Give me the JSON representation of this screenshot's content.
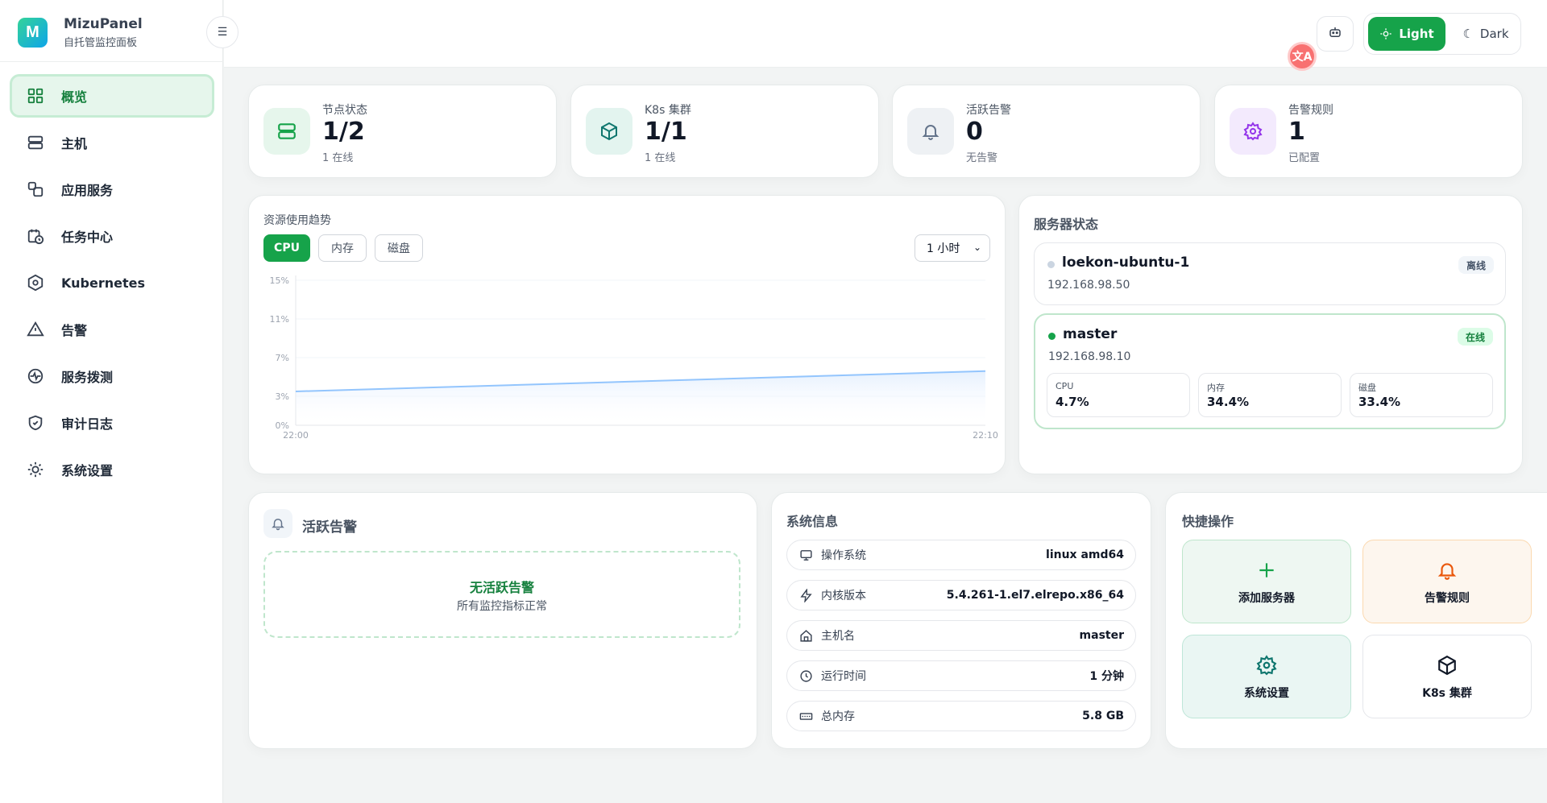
{
  "brand": {
    "name": "MizuPanel",
    "subtitle": "自托管监控面板",
    "logo_letter": "M"
  },
  "sidebar": {
    "items": [
      {
        "label": "概览",
        "icon": "grid-icon",
        "active": true
      },
      {
        "label": "主机",
        "icon": "server-icon"
      },
      {
        "label": "应用服务",
        "icon": "services-icon"
      },
      {
        "label": "任务中心",
        "icon": "calendar-clock-icon"
      },
      {
        "label": "Kubernetes",
        "icon": "kubernetes-icon"
      },
      {
        "label": "告警",
        "icon": "warning-icon"
      },
      {
        "label": "服务拨测",
        "icon": "pulse-icon"
      },
      {
        "label": "审计日志",
        "icon": "shield-icon"
      },
      {
        "label": "系统设置",
        "icon": "sun-gear-icon"
      }
    ]
  },
  "topbar": {
    "theme_light": "Light",
    "theme_dark": "Dark",
    "translate": "文A"
  },
  "stats": [
    {
      "label": "节点状态",
      "value": "1/2",
      "sub": "1 在线",
      "icon": "server-icon",
      "color": "#16a34a",
      "bg": "#e6f6ec"
    },
    {
      "label": "K8s 集群",
      "value": "1/1",
      "sub": "1 在线",
      "icon": "cube-icon",
      "color": "#0f766e",
      "bg": "#e3f4ef"
    },
    {
      "label": "活跃告警",
      "value": "0",
      "sub": "无告警",
      "icon": "bell-icon",
      "color": "#64748b",
      "bg": "#eef1f4"
    },
    {
      "label": "告警规则",
      "value": "1",
      "sub": "已配置",
      "icon": "gear-icon",
      "color": "#9333ea",
      "bg": "#f3eafd"
    }
  ],
  "trend": {
    "title": "资源使用趋势",
    "tabs": [
      "CPU",
      "内存",
      "磁盘"
    ],
    "range": "1 小时",
    "y_ticks": [
      "15%",
      "11%",
      "7%",
      "3%",
      "0%"
    ],
    "x_ticks": [
      "22:00",
      "22:10"
    ]
  },
  "chart_data": {
    "type": "area",
    "x": [
      "22:00",
      "22:10"
    ],
    "series": [
      {
        "values": [
          3.5,
          5.6
        ]
      }
    ],
    "ylim": [
      0,
      15
    ],
    "line_color": "#93c5fd",
    "grid": true
  },
  "server_status": {
    "title": "服务器状态",
    "servers": [
      {
        "name": "loekon-ubuntu-1",
        "ip": "192.168.98.50",
        "status": "离线",
        "online": false
      },
      {
        "name": "master",
        "ip": "192.168.98.10",
        "status": "在线",
        "online": true,
        "metrics": [
          {
            "label": "CPU",
            "value": "4.7%"
          },
          {
            "label": "内存",
            "value": "34.4%"
          },
          {
            "label": "磁盘",
            "value": "33.4%"
          }
        ]
      }
    ]
  },
  "active_alerts": {
    "title": "活跃告警",
    "empty_title": "无活跃告警",
    "empty_sub": "所有监控指标正常"
  },
  "system_info": {
    "title": "系统信息",
    "rows": [
      {
        "label": "操作系统",
        "value": "linux amd64",
        "icon": "monitor-icon"
      },
      {
        "label": "内核版本",
        "value": "5.4.261-1.el7.elrepo.x86_64",
        "icon": "bolt-icon"
      },
      {
        "label": "主机名",
        "value": "master",
        "icon": "home-icon"
      },
      {
        "label": "运行时间",
        "value": "1 分钟",
        "icon": "clock-icon"
      },
      {
        "label": "总内存",
        "value": "5.8 GB",
        "icon": "memory-icon"
      }
    ]
  },
  "quick_actions": {
    "title": "快捷操作",
    "items": [
      {
        "label": "添加服务器",
        "icon": "plus-icon"
      },
      {
        "label": "告警规则",
        "icon": "bell-icon"
      },
      {
        "label": "系统设置",
        "icon": "gear-icon"
      },
      {
        "label": "K8s 集群",
        "icon": "cube-icon"
      }
    ]
  }
}
